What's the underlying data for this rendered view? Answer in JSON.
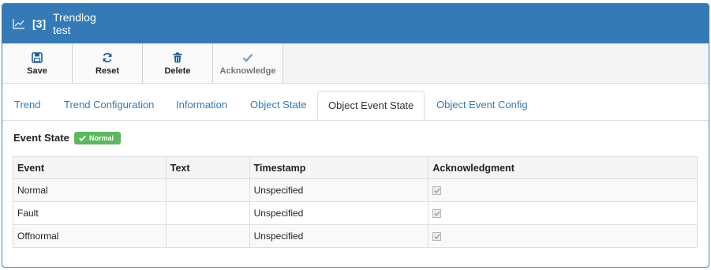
{
  "header": {
    "icon": "chart-line-icon",
    "object_number": "[3]",
    "title_line1": "Trendlog",
    "title_line2": "test"
  },
  "toolbar": {
    "save_label": "Save",
    "reset_label": "Reset",
    "delete_label": "Delete",
    "acknowledge_label": "Acknowledge"
  },
  "tabs": [
    {
      "label": "Trend"
    },
    {
      "label": "Trend Configuration"
    },
    {
      "label": "Information"
    },
    {
      "label": "Object State"
    },
    {
      "label": "Object Event State",
      "active": true
    },
    {
      "label": "Object Event Config"
    }
  ],
  "event_state": {
    "label": "Event State",
    "badge": "Normal",
    "badge_color": "#5cb85c"
  },
  "table": {
    "headers": [
      "Event",
      "Text",
      "Timestamp",
      "Acknowledgment"
    ],
    "rows": [
      {
        "event": "Normal",
        "text": "",
        "timestamp": "Unspecified",
        "acknowledged": true
      },
      {
        "event": "Fault",
        "text": "",
        "timestamp": "Unspecified",
        "acknowledged": true
      },
      {
        "event": "Offnormal",
        "text": "",
        "timestamp": "Unspecified",
        "acknowledged": true
      }
    ]
  },
  "colors": {
    "header_bg": "#337ab7",
    "link": "#337ab7"
  }
}
